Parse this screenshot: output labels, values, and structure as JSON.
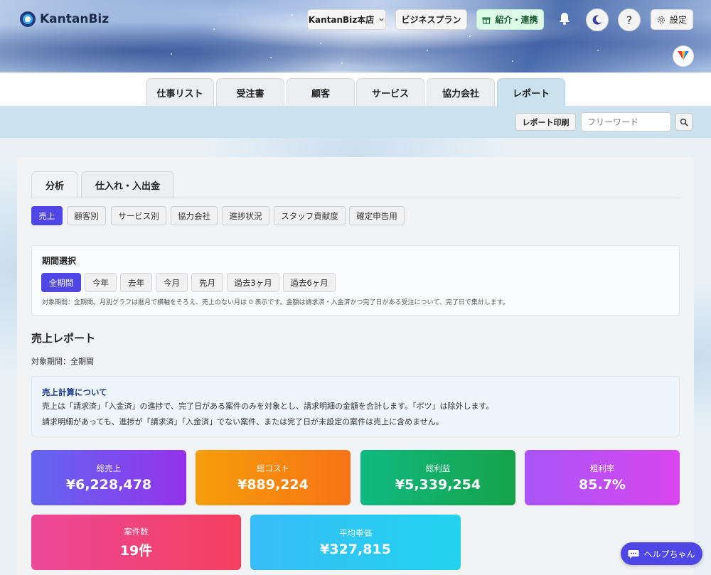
{
  "app": {
    "name": "KantanBiz"
  },
  "header": {
    "store_label": "KantanBiz本店",
    "plan_label": "ビジネスプラン",
    "referral_label": "紹介・連携",
    "help_glyph": "?",
    "settings_label": "設定"
  },
  "nav": {
    "tabs": [
      {
        "label": "仕事リスト"
      },
      {
        "label": "受注書"
      },
      {
        "label": "顧客"
      },
      {
        "label": "サービス"
      },
      {
        "label": "協力会社"
      },
      {
        "label": "レポート"
      }
    ],
    "active_tab": "レポート"
  },
  "subbar": {
    "print_label": "レポート印刷",
    "search_placeholder": "フリーワード"
  },
  "section_tabs": [
    {
      "label": "分析"
    },
    {
      "label": "仕入れ・入出金"
    }
  ],
  "report_tabs": [
    {
      "label": "売上"
    },
    {
      "label": "顧客別"
    },
    {
      "label": "サービス別"
    },
    {
      "label": "協力会社"
    },
    {
      "label": "進捗状況"
    },
    {
      "label": "スタッフ貢献度"
    },
    {
      "label": "確定申告用"
    }
  ],
  "period": {
    "title": "期間選択",
    "options": [
      {
        "label": "全期間"
      },
      {
        "label": "今年"
      },
      {
        "label": "去年"
      },
      {
        "label": "今月"
      },
      {
        "label": "先月"
      },
      {
        "label": "過去3ヶ月"
      },
      {
        "label": "過去6ヶ月"
      }
    ],
    "note": "対象期間：全期間。月別グラフは暦月で横軸をそろえ、売上のない月は 0 表示です。金額は請求済・入金済かつ完了日がある受注について、完了日で集計します。"
  },
  "report": {
    "title": "売上レポート",
    "period_label": "対象期間：全期間",
    "info_title": "売上計算について",
    "info_line1": "売上は「請求済」「入金済」の進捗で、完了日がある案件のみを対象とし、請求明細の金額を合計します。「ボツ」は除外します。",
    "info_line2": "請求明細があっても、進捗が「請求済」「入金済」でない案件、または完了日が未設定の案件は売上に含めません。"
  },
  "summary_cards": [
    {
      "label": "総売上",
      "value": "¥6,228,478",
      "color_from": "#6366f1",
      "color_to": "#9333ea"
    },
    {
      "label": "総コスト",
      "value": "¥889,224",
      "color_from": "#f59e0b",
      "color_to": "#f97316"
    },
    {
      "label": "総利益",
      "value": "¥5,339,254",
      "color_from": "#10b981",
      "color_to": "#16a34a"
    },
    {
      "label": "粗利率",
      "value": "85.7%",
      "color_from": "#a855f7",
      "color_to": "#d946ef"
    },
    {
      "label": "案件数",
      "value": "19件",
      "color_from": "#ec4899",
      "color_to": "#f43f5e"
    },
    {
      "label": "平均単価",
      "value": "¥327,815",
      "color_from": "#38bdf8",
      "color_to": "#22d3ee"
    }
  ],
  "help": {
    "label": "ヘルプちゃん"
  },
  "colors": {
    "accent": "#4f46e5",
    "subbar": "#cbe2ee"
  }
}
